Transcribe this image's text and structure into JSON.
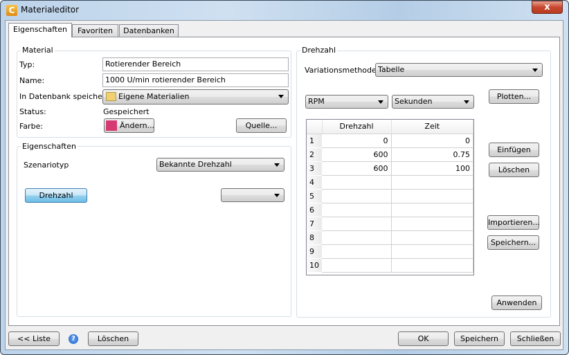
{
  "window": {
    "title": "Materialeditor",
    "close": "x"
  },
  "tabs": [
    "Eigenschaften",
    "Favoriten",
    "Datenbanken"
  ],
  "material": {
    "legend": "Material",
    "typ_label": "Typ:",
    "typ_value": "Rotierender Bereich",
    "name_label": "Name:",
    "name_value": "1000 U/min rotierender Bereich",
    "db_label": "In Datenbank speichern:",
    "db_value": "Eigene Materialien",
    "status_label": "Status:",
    "status_value": "Gespeichert",
    "farbe_label": "Farbe:",
    "aendern": "Ändern...",
    "quelle": "Quelle...",
    "color": "#d63a72"
  },
  "eigenschaften": {
    "legend": "Eigenschaften",
    "szenario_label": "Szenariotyp",
    "szenario_value": "Bekannte Drehzahl",
    "drehzahl_button": "Drehzahl",
    "empty_select": ""
  },
  "drehzahl": {
    "legend": "Drehzahl",
    "variation_label": "Variationsmethode:",
    "variation_value": "Tabelle",
    "unit1": "RPM",
    "unit2": "Sekunden",
    "plotten": "Plotten...",
    "einfuegen": "Einfügen",
    "loeschen": "Löschen",
    "importieren": "Importieren...",
    "speichern": "Speichern...",
    "anwenden": "Anwenden",
    "table": {
      "headers": [
        "Drehzahl",
        "Zeit"
      ],
      "rows": [
        [
          "1",
          "0",
          "0"
        ],
        [
          "2",
          "600",
          "0.75"
        ],
        [
          "3",
          "600",
          "100"
        ],
        [
          "4",
          "",
          ""
        ],
        [
          "5",
          "",
          ""
        ],
        [
          "6",
          "",
          ""
        ],
        [
          "7",
          "",
          ""
        ],
        [
          "8",
          "",
          ""
        ],
        [
          "9",
          "",
          ""
        ],
        [
          "10",
          "",
          ""
        ]
      ]
    }
  },
  "footer": {
    "liste": "<< Liste",
    "help": "?",
    "loeschen": "Löschen",
    "ok": "OK",
    "speichern": "Speichern",
    "schliessen": "Schließen"
  }
}
